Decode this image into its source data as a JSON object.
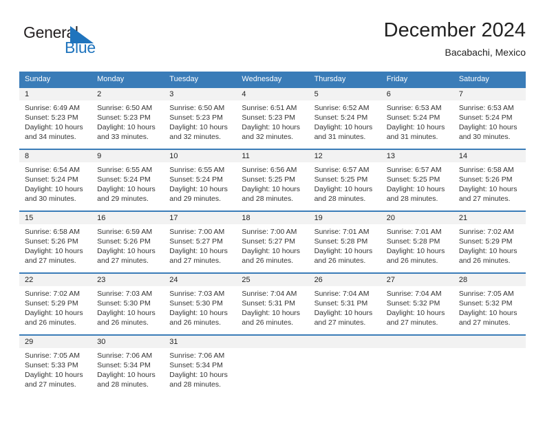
{
  "brand": {
    "name_top": "General",
    "name_bottom": "Blue",
    "flag_color": "#1f74bd",
    "top_color": "#231f20"
  },
  "header": {
    "title": "December 2024",
    "location": "Bacabachi, Mexico"
  },
  "theme": {
    "header_blue": "#3a7cb8",
    "daynum_band": "#f2f2f2"
  },
  "weekdays": [
    "Sunday",
    "Monday",
    "Tuesday",
    "Wednesday",
    "Thursday",
    "Friday",
    "Saturday"
  ],
  "weeks": [
    {
      "days": [
        {
          "num": "1",
          "sunrise": "Sunrise: 6:49 AM",
          "sunset": "Sunset: 5:23 PM",
          "daylight1": "Daylight: 10 hours",
          "daylight2": "and 34 minutes."
        },
        {
          "num": "2",
          "sunrise": "Sunrise: 6:50 AM",
          "sunset": "Sunset: 5:23 PM",
          "daylight1": "Daylight: 10 hours",
          "daylight2": "and 33 minutes."
        },
        {
          "num": "3",
          "sunrise": "Sunrise: 6:50 AM",
          "sunset": "Sunset: 5:23 PM",
          "daylight1": "Daylight: 10 hours",
          "daylight2": "and 32 minutes."
        },
        {
          "num": "4",
          "sunrise": "Sunrise: 6:51 AM",
          "sunset": "Sunset: 5:23 PM",
          "daylight1": "Daylight: 10 hours",
          "daylight2": "and 32 minutes."
        },
        {
          "num": "5",
          "sunrise": "Sunrise: 6:52 AM",
          "sunset": "Sunset: 5:24 PM",
          "daylight1": "Daylight: 10 hours",
          "daylight2": "and 31 minutes."
        },
        {
          "num": "6",
          "sunrise": "Sunrise: 6:53 AM",
          "sunset": "Sunset: 5:24 PM",
          "daylight1": "Daylight: 10 hours",
          "daylight2": "and 31 minutes."
        },
        {
          "num": "7",
          "sunrise": "Sunrise: 6:53 AM",
          "sunset": "Sunset: 5:24 PM",
          "daylight1": "Daylight: 10 hours",
          "daylight2": "and 30 minutes."
        }
      ]
    },
    {
      "days": [
        {
          "num": "8",
          "sunrise": "Sunrise: 6:54 AM",
          "sunset": "Sunset: 5:24 PM",
          "daylight1": "Daylight: 10 hours",
          "daylight2": "and 30 minutes."
        },
        {
          "num": "9",
          "sunrise": "Sunrise: 6:55 AM",
          "sunset": "Sunset: 5:24 PM",
          "daylight1": "Daylight: 10 hours",
          "daylight2": "and 29 minutes."
        },
        {
          "num": "10",
          "sunrise": "Sunrise: 6:55 AM",
          "sunset": "Sunset: 5:24 PM",
          "daylight1": "Daylight: 10 hours",
          "daylight2": "and 29 minutes."
        },
        {
          "num": "11",
          "sunrise": "Sunrise: 6:56 AM",
          "sunset": "Sunset: 5:25 PM",
          "daylight1": "Daylight: 10 hours",
          "daylight2": "and 28 minutes."
        },
        {
          "num": "12",
          "sunrise": "Sunrise: 6:57 AM",
          "sunset": "Sunset: 5:25 PM",
          "daylight1": "Daylight: 10 hours",
          "daylight2": "and 28 minutes."
        },
        {
          "num": "13",
          "sunrise": "Sunrise: 6:57 AM",
          "sunset": "Sunset: 5:25 PM",
          "daylight1": "Daylight: 10 hours",
          "daylight2": "and 28 minutes."
        },
        {
          "num": "14",
          "sunrise": "Sunrise: 6:58 AM",
          "sunset": "Sunset: 5:26 PM",
          "daylight1": "Daylight: 10 hours",
          "daylight2": "and 27 minutes."
        }
      ]
    },
    {
      "days": [
        {
          "num": "15",
          "sunrise": "Sunrise: 6:58 AM",
          "sunset": "Sunset: 5:26 PM",
          "daylight1": "Daylight: 10 hours",
          "daylight2": "and 27 minutes."
        },
        {
          "num": "16",
          "sunrise": "Sunrise: 6:59 AM",
          "sunset": "Sunset: 5:26 PM",
          "daylight1": "Daylight: 10 hours",
          "daylight2": "and 27 minutes."
        },
        {
          "num": "17",
          "sunrise": "Sunrise: 7:00 AM",
          "sunset": "Sunset: 5:27 PM",
          "daylight1": "Daylight: 10 hours",
          "daylight2": "and 27 minutes."
        },
        {
          "num": "18",
          "sunrise": "Sunrise: 7:00 AM",
          "sunset": "Sunset: 5:27 PM",
          "daylight1": "Daylight: 10 hours",
          "daylight2": "and 26 minutes."
        },
        {
          "num": "19",
          "sunrise": "Sunrise: 7:01 AM",
          "sunset": "Sunset: 5:28 PM",
          "daylight1": "Daylight: 10 hours",
          "daylight2": "and 26 minutes."
        },
        {
          "num": "20",
          "sunrise": "Sunrise: 7:01 AM",
          "sunset": "Sunset: 5:28 PM",
          "daylight1": "Daylight: 10 hours",
          "daylight2": "and 26 minutes."
        },
        {
          "num": "21",
          "sunrise": "Sunrise: 7:02 AM",
          "sunset": "Sunset: 5:29 PM",
          "daylight1": "Daylight: 10 hours",
          "daylight2": "and 26 minutes."
        }
      ]
    },
    {
      "days": [
        {
          "num": "22",
          "sunrise": "Sunrise: 7:02 AM",
          "sunset": "Sunset: 5:29 PM",
          "daylight1": "Daylight: 10 hours",
          "daylight2": "and 26 minutes."
        },
        {
          "num": "23",
          "sunrise": "Sunrise: 7:03 AM",
          "sunset": "Sunset: 5:30 PM",
          "daylight1": "Daylight: 10 hours",
          "daylight2": "and 26 minutes."
        },
        {
          "num": "24",
          "sunrise": "Sunrise: 7:03 AM",
          "sunset": "Sunset: 5:30 PM",
          "daylight1": "Daylight: 10 hours",
          "daylight2": "and 26 minutes."
        },
        {
          "num": "25",
          "sunrise": "Sunrise: 7:04 AM",
          "sunset": "Sunset: 5:31 PM",
          "daylight1": "Daylight: 10 hours",
          "daylight2": "and 26 minutes."
        },
        {
          "num": "26",
          "sunrise": "Sunrise: 7:04 AM",
          "sunset": "Sunset: 5:31 PM",
          "daylight1": "Daylight: 10 hours",
          "daylight2": "and 27 minutes."
        },
        {
          "num": "27",
          "sunrise": "Sunrise: 7:04 AM",
          "sunset": "Sunset: 5:32 PM",
          "daylight1": "Daylight: 10 hours",
          "daylight2": "and 27 minutes."
        },
        {
          "num": "28",
          "sunrise": "Sunrise: 7:05 AM",
          "sunset": "Sunset: 5:32 PM",
          "daylight1": "Daylight: 10 hours",
          "daylight2": "and 27 minutes."
        }
      ]
    },
    {
      "days": [
        {
          "num": "29",
          "sunrise": "Sunrise: 7:05 AM",
          "sunset": "Sunset: 5:33 PM",
          "daylight1": "Daylight: 10 hours",
          "daylight2": "and 27 minutes."
        },
        {
          "num": "30",
          "sunrise": "Sunrise: 7:06 AM",
          "sunset": "Sunset: 5:34 PM",
          "daylight1": "Daylight: 10 hours",
          "daylight2": "and 28 minutes."
        },
        {
          "num": "31",
          "sunrise": "Sunrise: 7:06 AM",
          "sunset": "Sunset: 5:34 PM",
          "daylight1": "Daylight: 10 hours",
          "daylight2": "and 28 minutes."
        },
        {
          "num": "",
          "sunrise": "",
          "sunset": "",
          "daylight1": "",
          "daylight2": ""
        },
        {
          "num": "",
          "sunrise": "",
          "sunset": "",
          "daylight1": "",
          "daylight2": ""
        },
        {
          "num": "",
          "sunrise": "",
          "sunset": "",
          "daylight1": "",
          "daylight2": ""
        },
        {
          "num": "",
          "sunrise": "",
          "sunset": "",
          "daylight1": "",
          "daylight2": ""
        }
      ]
    }
  ]
}
